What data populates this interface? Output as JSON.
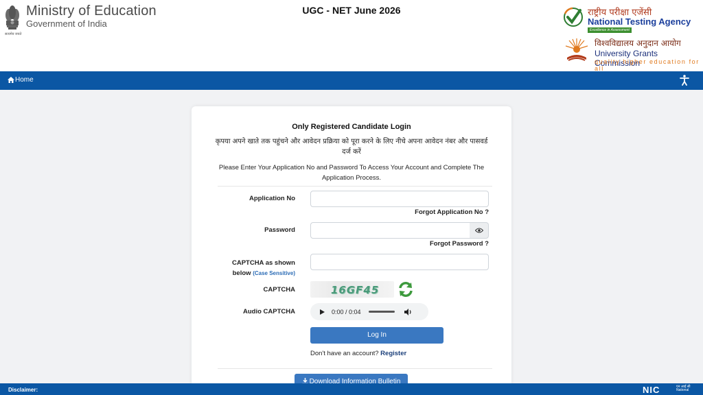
{
  "header": {
    "ministry": "Ministry of Education",
    "government": "Government of India",
    "emblem_caption": "सत्यमेव जयते",
    "exam_title": "UGC - NET June 2026",
    "nta_hindi": "राष्ट्रीय परीक्षा एजेंसी",
    "nta_english": "National Testing Agency",
    "nta_tagline": "Excellence in Assessment",
    "ugc_hindi": "विश्वविद्यालय अनुदान आयोग",
    "ugc_english": "University Grants Commission",
    "ugc_tagline": "quality higher education for all"
  },
  "nav": {
    "home": "Home",
    "accessibility_icon": "accessibility-icon"
  },
  "login": {
    "title": "Only Registered Candidate Login",
    "hindi_instruction": "कृपया अपने खाते तक पहुंचने और आवेदन प्रक्रिया को पूरा करने के लिए नीचे अपना आवेदन नंबर और पासवर्ड दर्ज करें",
    "english_instruction": "Please Enter Your Application No and Password To Access Your Account and Complete The Application Process.",
    "application_no_label": "Application No",
    "application_no_value": "",
    "forgot_application": "Forgot Application No ?",
    "password_label": "Password",
    "password_value": "",
    "forgot_password": "Forgot Password ?",
    "captcha_label_1": "CAPTCHA as shown",
    "captcha_label_2": "below",
    "case_sensitive": "(Case Sensitive)",
    "captcha_value": "",
    "captcha_image_label": "CAPTCHA",
    "captcha_text": "16GF45",
    "audio_captcha_label": "Audio CAPTCHA",
    "audio_time": "0:00 / 0:04",
    "login_button": "Log In",
    "no_account": "Don't have an account?",
    "register": "Register",
    "download_bulletin": "Download Information Bulletin"
  },
  "footer": {
    "disclaimer": "Disclaimer:",
    "nic": "NIC",
    "nic_small_hi": "एन आई सी",
    "nic_small_en": "National"
  },
  "colors": {
    "nav_blue": "#0b57a4",
    "button_blue": "#3a78c1",
    "page_bg": "#f1f2f4"
  }
}
